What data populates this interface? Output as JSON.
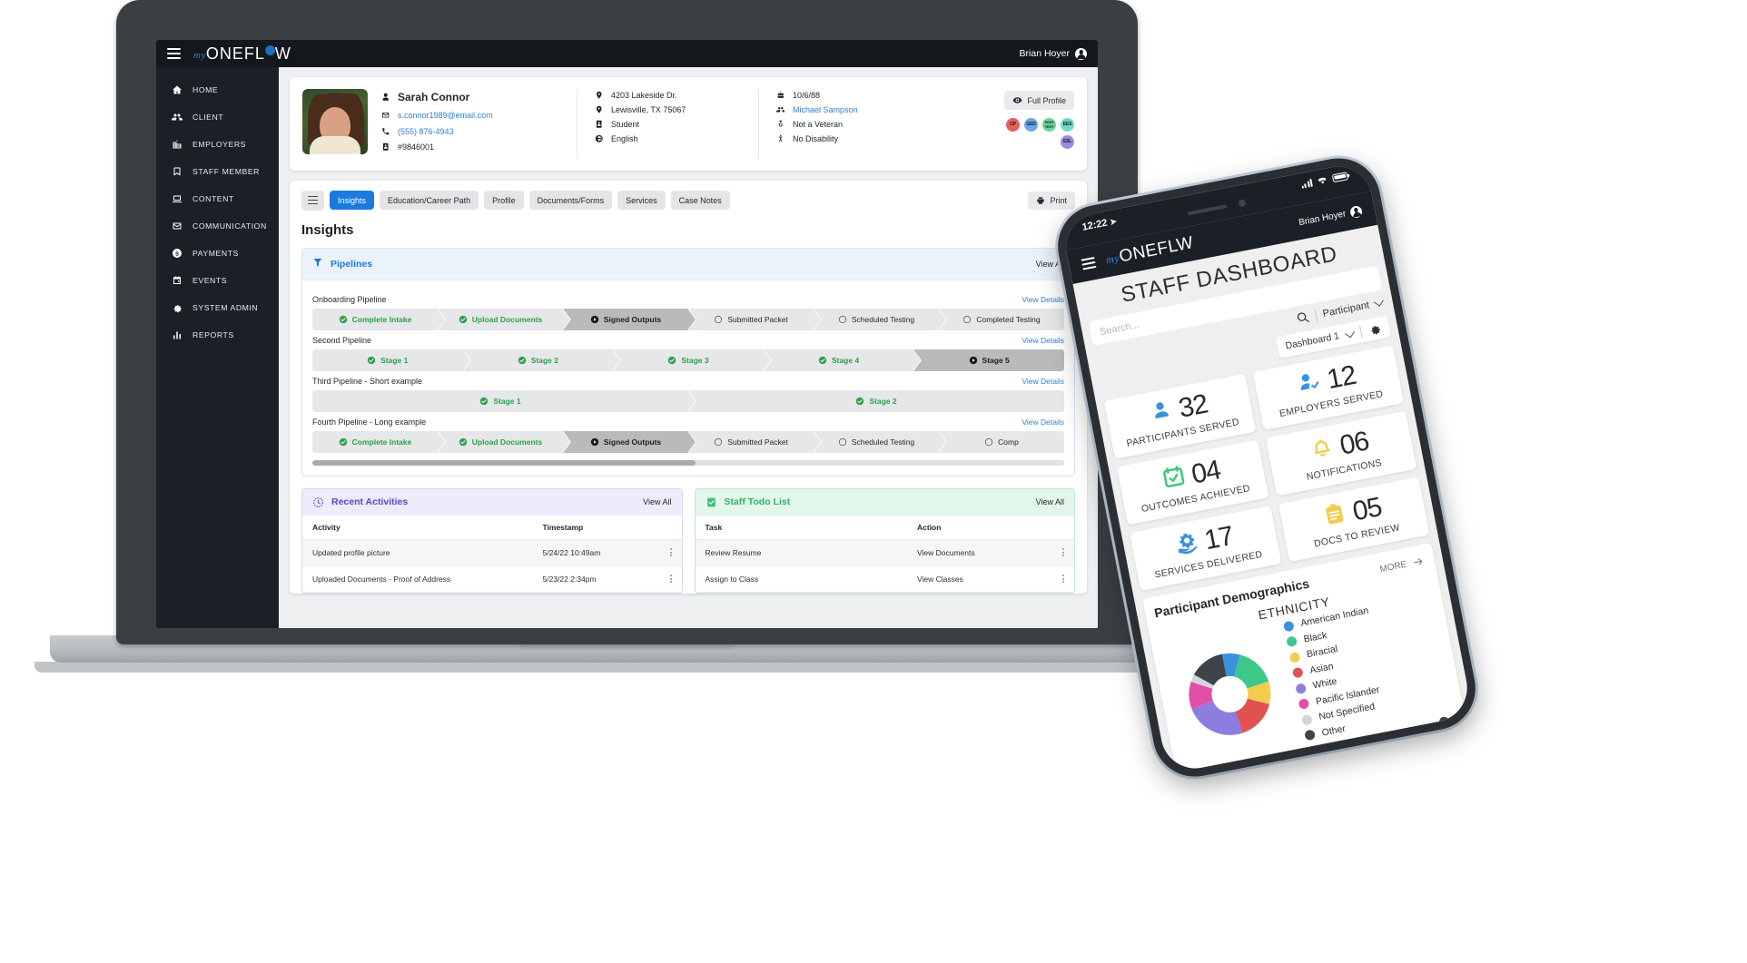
{
  "desktop": {
    "topbar": {
      "brand_my": "my",
      "brand_rest": "ONEFLOW",
      "user": "Brian Hoyer"
    },
    "sidebar": {
      "items": [
        {
          "label": "HOME",
          "icon": "home-icon"
        },
        {
          "label": "CLIENT",
          "icon": "people-icon"
        },
        {
          "label": "EMPLOYERS",
          "icon": "building-icon"
        },
        {
          "label": "STAFF MEMBER",
          "icon": "bookmark-icon"
        },
        {
          "label": "CONTENT",
          "icon": "laptop-icon"
        },
        {
          "label": "COMMUNICATION",
          "icon": "envelope-icon"
        },
        {
          "label": "PAYMENTS",
          "icon": "dollar-icon"
        },
        {
          "label": "EVENTS",
          "icon": "calendar-icon"
        },
        {
          "label": "SYSTEM ADMIN",
          "icon": "gear-icon"
        },
        {
          "label": "REPORTS",
          "icon": "bar-chart-icon"
        }
      ]
    },
    "profile": {
      "name": "Sarah Connor",
      "email": "s.connor1989@email.com",
      "phone": "(555) 876-4943",
      "id": "#9846001",
      "address_line1": "4203 Lakeside Dr.",
      "address_line2": "Lewisville, TX 75067",
      "status": "Student",
      "language": "English",
      "birthdate": "10/6/88",
      "case_manager": "Michael Sampson",
      "veteran": "Not a Veteran",
      "disability": "No Disability",
      "full_profile_label": "Full Profile",
      "badges": [
        {
          "label": "CP",
          "color": "#e2615f"
        },
        {
          "label": "GED",
          "color": "#6aa7e8"
        },
        {
          "label": "POST TEST",
          "color": "#6ad49a"
        },
        {
          "label": "EES",
          "color": "#6fd9c9"
        },
        {
          "label": "ESL",
          "color": "#9b8ce0"
        }
      ]
    },
    "tabs": [
      {
        "label": "Insights",
        "active": true
      },
      {
        "label": "Education/Career Path",
        "active": false
      },
      {
        "label": "Profile",
        "active": false
      },
      {
        "label": "Documents/Forms",
        "active": false
      },
      {
        "label": "Services",
        "active": false
      },
      {
        "label": "Case Notes",
        "active": false
      }
    ],
    "print_label": "Print",
    "page_title": "Insights",
    "pipelines_panel": {
      "title": "Pipelines",
      "view_all": "View All",
      "view_details": "View Details",
      "pipelines": [
        {
          "name": "Onboarding Pipeline",
          "stages": [
            {
              "label": "Complete Intake",
              "state": "done"
            },
            {
              "label": "Upload Documents",
              "state": "done"
            },
            {
              "label": "Signed Outputs",
              "state": "current"
            },
            {
              "label": "Submitted Packet",
              "state": "todo"
            },
            {
              "label": "Scheduled Testing",
              "state": "todo"
            },
            {
              "label": "Completed Testing",
              "state": "todo"
            }
          ]
        },
        {
          "name": "Second Pipeline",
          "stages": [
            {
              "label": "Stage 1",
              "state": "done"
            },
            {
              "label": "Stage 2",
              "state": "done"
            },
            {
              "label": "Stage 3",
              "state": "done"
            },
            {
              "label": "Stage 4",
              "state": "done"
            },
            {
              "label": "Stage 5",
              "state": "current"
            }
          ]
        },
        {
          "name": "Third Pipeline - Short example",
          "stages": [
            {
              "label": "Stage 1",
              "state": "done"
            },
            {
              "label": "Stage 2",
              "state": "done"
            }
          ]
        },
        {
          "name": "Fourth Pipeline - Long example",
          "stages": [
            {
              "label": "Complete Intake",
              "state": "done"
            },
            {
              "label": "Upload Documents",
              "state": "done"
            },
            {
              "label": "Signed Outputs",
              "state": "current"
            },
            {
              "label": "Submitted Packet",
              "state": "todo"
            },
            {
              "label": "Scheduled Testing",
              "state": "todo"
            },
            {
              "label": "Comp",
              "state": "todo"
            }
          ]
        }
      ]
    },
    "recent_activities": {
      "title": "Recent Activities",
      "view_all": "View All",
      "columns": [
        "Activity",
        "Timestamp"
      ],
      "rows": [
        {
          "activity": "Updated profile picture",
          "timestamp": "5/24/22  10:49am"
        },
        {
          "activity": "Uploaded Documents - Proof of Address",
          "timestamp": "5/23/22  2:34pm"
        }
      ]
    },
    "staff_todo": {
      "title": "Staff Todo List",
      "view_all": "View All",
      "columns": [
        "Task",
        "Action"
      ],
      "rows": [
        {
          "task": "Review Resume",
          "action": "View Documents"
        },
        {
          "task": "Assign to Class",
          "action": "View Classes"
        }
      ]
    }
  },
  "mobile": {
    "status_time": "12:22",
    "brand_my": "my",
    "brand_rest": "ONEFLOW",
    "user": "Brian Hoyer",
    "title": "STAFF DASHBOARD",
    "search_placeholder": "Search...",
    "filter_label": "Participant",
    "dashboard_select": "Dashboard 1",
    "stats": [
      {
        "value": "32",
        "label": "PARTICIPANTS SERVED",
        "icon": "person-icon",
        "color": "#3a91e0"
      },
      {
        "value": "12",
        "label": "EMPLOYERS SERVED",
        "icon": "person-check-icon",
        "color": "#3a91e0"
      },
      {
        "value": "04",
        "label": "OUTCOMES ACHIEVED",
        "icon": "calendar-check-icon",
        "color": "#3fc97a"
      },
      {
        "value": "06",
        "label": "NOTIFICATIONS",
        "icon": "bell-icon",
        "color": "#f2cd4b"
      },
      {
        "value": "17",
        "label": "SERVICES DELIVERED",
        "icon": "hand-gear-icon",
        "color": "#3a91e0"
      },
      {
        "value": "05",
        "label": "DOCS TO REVIEW",
        "icon": "clipboard-icon",
        "color": "#f2cd4b"
      }
    ],
    "demographics": {
      "title": "Participant Demographics",
      "more_label": "MORE",
      "subtitle": "ETHNICITY"
    }
  },
  "chart_data": {
    "type": "pie",
    "title": "ETHNICITY",
    "subtitle": "Participant Demographics",
    "legend_position": "right",
    "categories": [
      "American Indian",
      "Black",
      "Biracial",
      "Asian",
      "White",
      "Pacific Islander",
      "Not Specified",
      "Other"
    ],
    "values": [
      7,
      16,
      9,
      16,
      24,
      11,
      3,
      14
    ],
    "colors": [
      "#3a91e0",
      "#3ec98a",
      "#f2ce4e",
      "#e1514f",
      "#8d7de0",
      "#e24fa7",
      "#d2d6da",
      "#3f4449"
    ],
    "units": "percent"
  }
}
